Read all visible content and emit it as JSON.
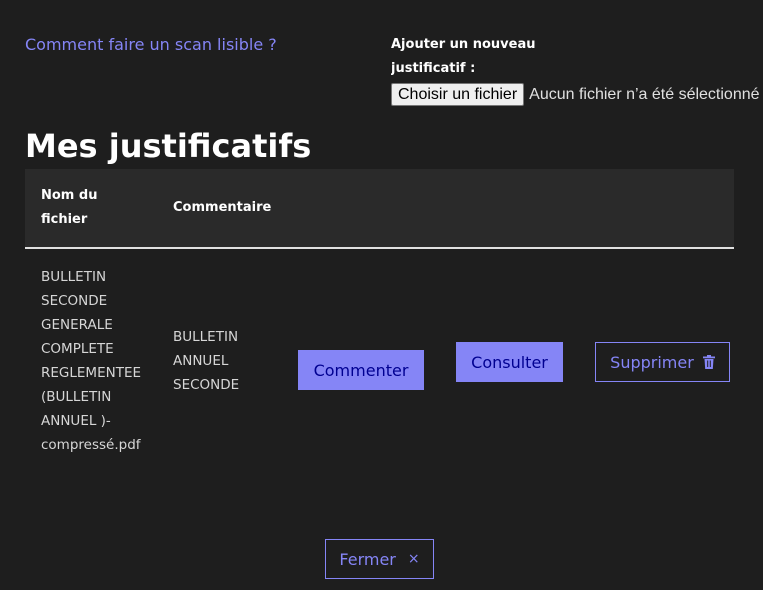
{
  "help": {
    "link_label": "Comment faire un scan lisible ?"
  },
  "upload": {
    "label": "Ajouter un nouveau justificatif :",
    "button_label": "Choisir un fichier",
    "status": "Aucun fichier n’a été sélectionné"
  },
  "section": {
    "title": "Mes justificatifs"
  },
  "table": {
    "headers": [
      "Nom du fichier",
      "Commentaire"
    ],
    "rows": [
      {
        "file_name": "BULLETIN SECONDE GENERALE COMPLETE REGLEMENTEE (BULLETIN ANNUEL )-compressé.pdf",
        "comment": "BULLETIN ANNUEL SECONDE",
        "actions": {
          "comment_label": "Commenter",
          "view_label": "Consulter",
          "delete_label": "Supprimer"
        }
      }
    ]
  },
  "footer": {
    "close_label": "Fermer",
    "close_icon": "×"
  },
  "colors": {
    "background": "#1e1e1e",
    "accent": "#8585f6",
    "accent_text": "#000091",
    "header_bg": "#2a2a2a"
  },
  "icons": {
    "delete": "trash-icon",
    "close": "close-icon"
  }
}
